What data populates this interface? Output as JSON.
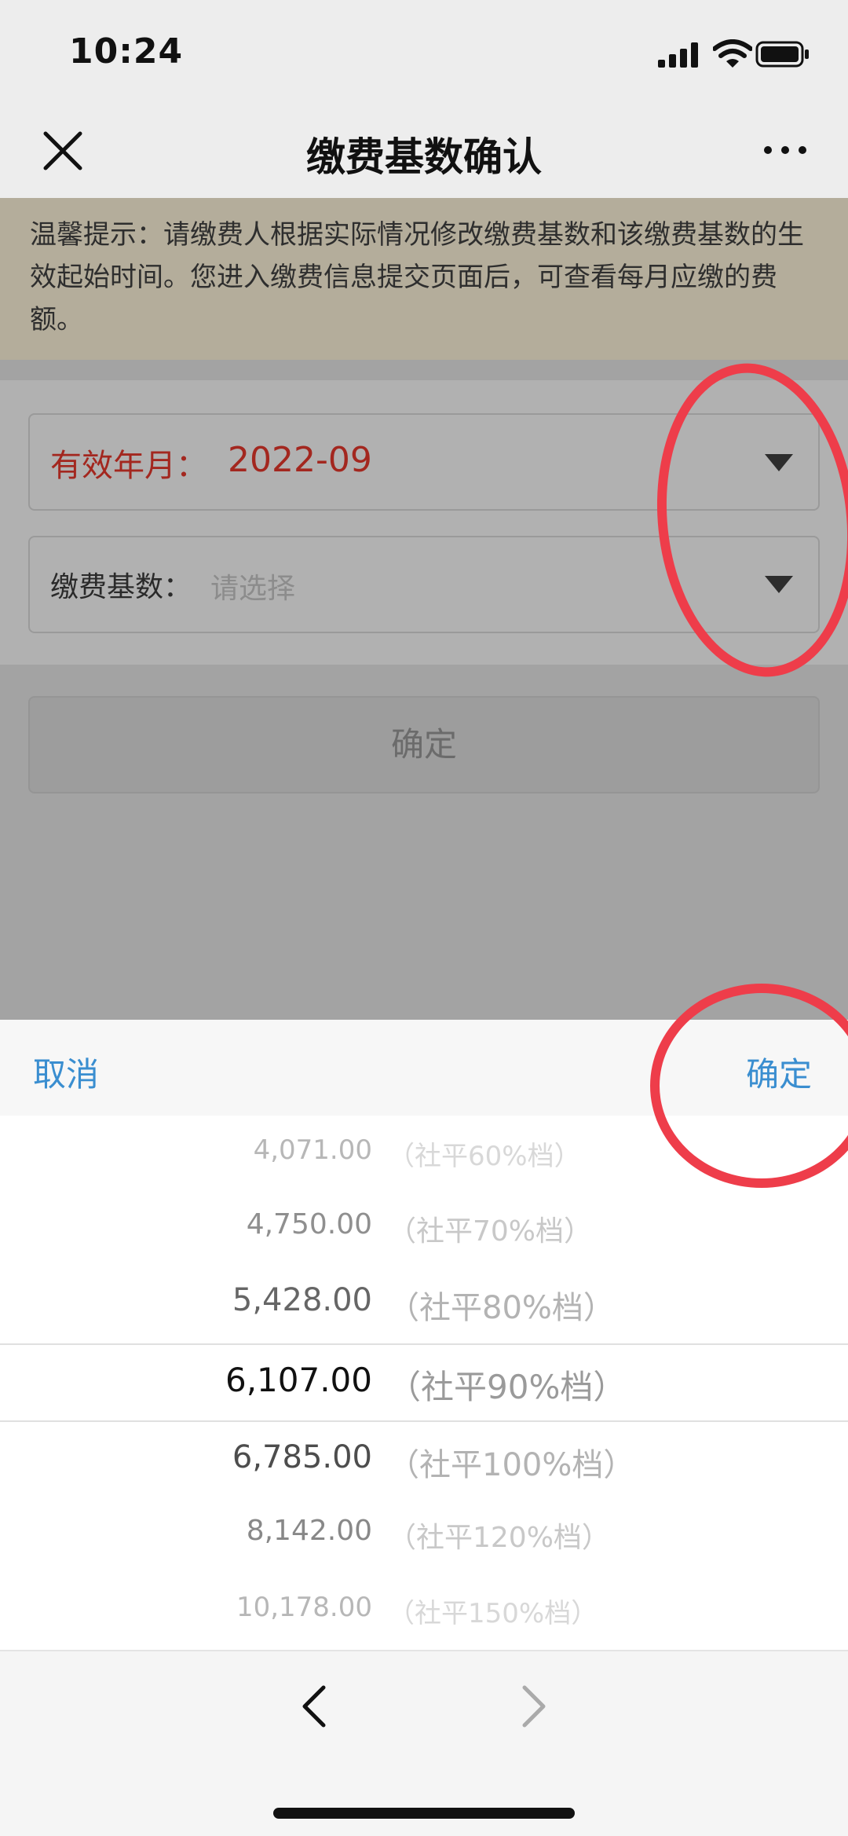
{
  "status_bar": {
    "time": "10:24"
  },
  "nav": {
    "title": "缴费基数确认"
  },
  "tip": {
    "text": "温馨提示：请缴费人根据实际情况修改缴费基数和该缴费基数的生效起始时间。您进入缴费信息提交页面后，可查看每月应缴的费额。"
  },
  "form": {
    "effective_label": "有效年月：",
    "effective_value": "2022-09",
    "base_label": "缴费基数：",
    "base_placeholder": "请选择",
    "confirm_label": "确定"
  },
  "picker": {
    "cancel_label": "取消",
    "confirm_label": "确定",
    "options": [
      {
        "amount": "4,071.00",
        "tier": "（社平60%档）"
      },
      {
        "amount": "4,750.00",
        "tier": "（社平70%档）"
      },
      {
        "amount": "5,428.00",
        "tier": "（社平80%档）"
      },
      {
        "amount": "6,107.00",
        "tier": "（社平90%档）"
      },
      {
        "amount": "6,785.00",
        "tier": "（社平100%档）"
      },
      {
        "amount": "8,142.00",
        "tier": "（社平120%档）"
      },
      {
        "amount": "10,178.00",
        "tier": "（社平150%档）"
      }
    ]
  },
  "colors": {
    "accent_blue": "#3a8ed0",
    "alert_red": "#a3271f",
    "annotation_red": "#ee3d4a"
  },
  "icons": [
    "close-icon",
    "more-icon",
    "dropdown-caret-icon",
    "back-chevron-icon",
    "forward-chevron-icon",
    "signal-icon",
    "wifi-icon",
    "battery-icon"
  ]
}
